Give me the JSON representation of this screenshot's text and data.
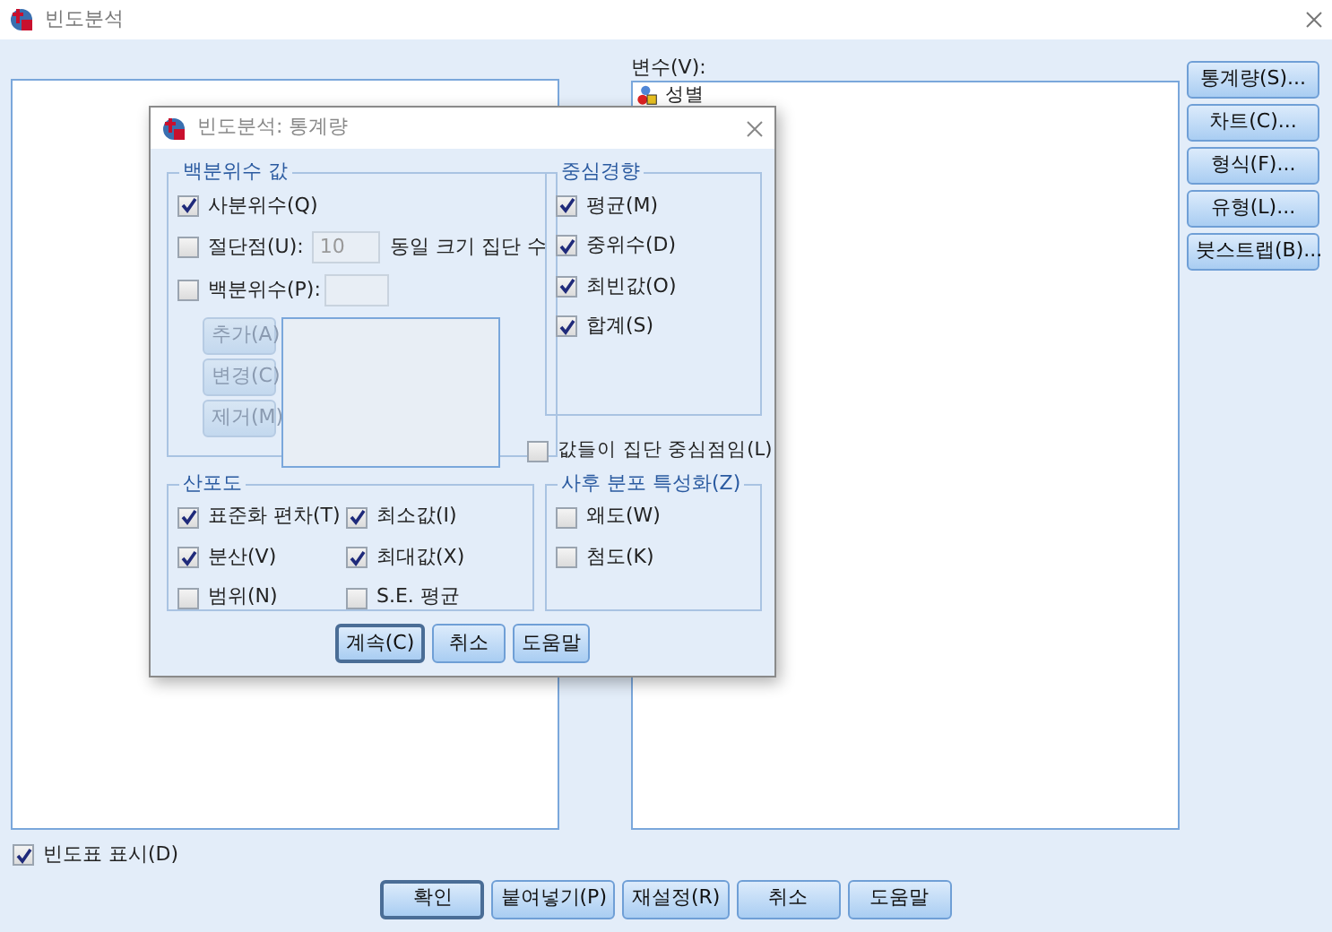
{
  "window": {
    "title": "빈도분석"
  },
  "variables": {
    "label": "변수(V):",
    "items": [
      {
        "name": "성별"
      }
    ]
  },
  "side_buttons": [
    "통계량(S)...",
    "차트(C)...",
    "형식(F)...",
    "유형(L)...",
    "붓스트랩(B)..."
  ],
  "show_tables": {
    "label": "빈도표 표시(D)",
    "checked": true
  },
  "buttons": [
    {
      "label": "확인",
      "default": true
    },
    {
      "label": "붙여넣기(P)",
      "default": false
    },
    {
      "label": "재설정(R)",
      "default": false
    },
    {
      "label": "취소",
      "default": false
    },
    {
      "label": "도움말",
      "default": false
    }
  ],
  "dialog": {
    "title": "빈도분석: 통계량",
    "percentile_values": {
      "title": "백분위수 값",
      "quartiles": {
        "label": "사분위수(Q)",
        "checked": true
      },
      "cut_points": {
        "label": "절단점(U):",
        "checked": false,
        "value": "10",
        "suffix": "동일 크기 집단 수",
        "disabled": true
      },
      "percentiles": {
        "label": "백분위수(P):",
        "checked": false
      },
      "list_buttons": [
        {
          "label": "추가(A)",
          "disabled": true
        },
        {
          "label": "변경(C)",
          "disabled": true
        },
        {
          "label": "제거(M)",
          "disabled": true
        }
      ]
    },
    "central_tendency": {
      "title": "중심경향",
      "options": [
        {
          "label": "평균(M)",
          "checked": true
        },
        {
          "label": "중위수(D)",
          "checked": true
        },
        {
          "label": "최빈값(O)",
          "checked": true
        },
        {
          "label": "합계(S)",
          "checked": true
        }
      ]
    },
    "group_midpoints": {
      "label": "값들이 집단 중심점임(L)",
      "checked": false
    },
    "dispersion": {
      "title": "산포도",
      "options": [
        {
          "label": "표준화 편차(T)",
          "checked": true
        },
        {
          "label": "최소값(I)",
          "checked": true
        },
        {
          "label": "분산(V)",
          "checked": true
        },
        {
          "label": "최대값(X)",
          "checked": true
        },
        {
          "label": "범위(N)",
          "checked": false
        },
        {
          "label": "S.E. 평균",
          "checked": false
        }
      ]
    },
    "distribution": {
      "title": "사후 분포 특성화(Z)",
      "options": [
        {
          "label": "왜도(W)",
          "checked": false
        },
        {
          "label": "첨도(K)",
          "checked": false
        }
      ]
    },
    "buttons": [
      {
        "label": "계속(C)",
        "default": true
      },
      {
        "label": "취소",
        "default": false
      },
      {
        "label": "도움말",
        "default": false
      }
    ]
  }
}
